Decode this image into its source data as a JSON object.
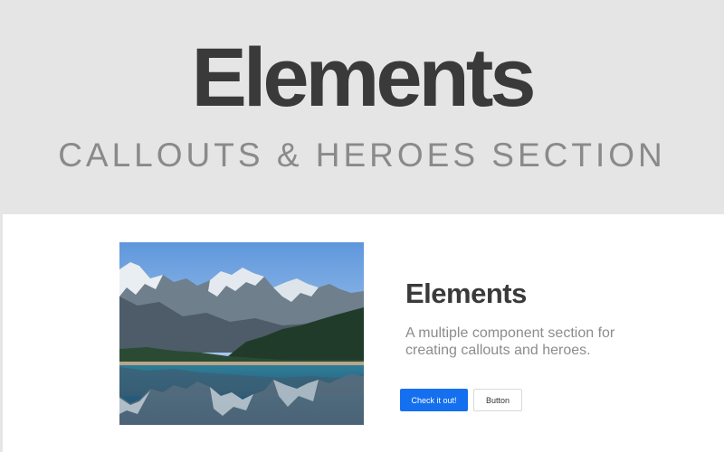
{
  "banner": {
    "title": "Elements",
    "subtitle": "CALLOUTS & HEROES SECTION"
  },
  "callout": {
    "title": "Elements",
    "text": "A multiple component section for creating callouts and heroes.",
    "primary_button_label": "Check it out!",
    "secondary_button_label": "Button"
  },
  "colors": {
    "banner_background": "#e5e5e5",
    "primary_button": "#1570ef",
    "title_text": "#3a3a3a",
    "muted_text": "#8c8c8c"
  },
  "image": {
    "subject": "mountain-lake-landscape"
  }
}
